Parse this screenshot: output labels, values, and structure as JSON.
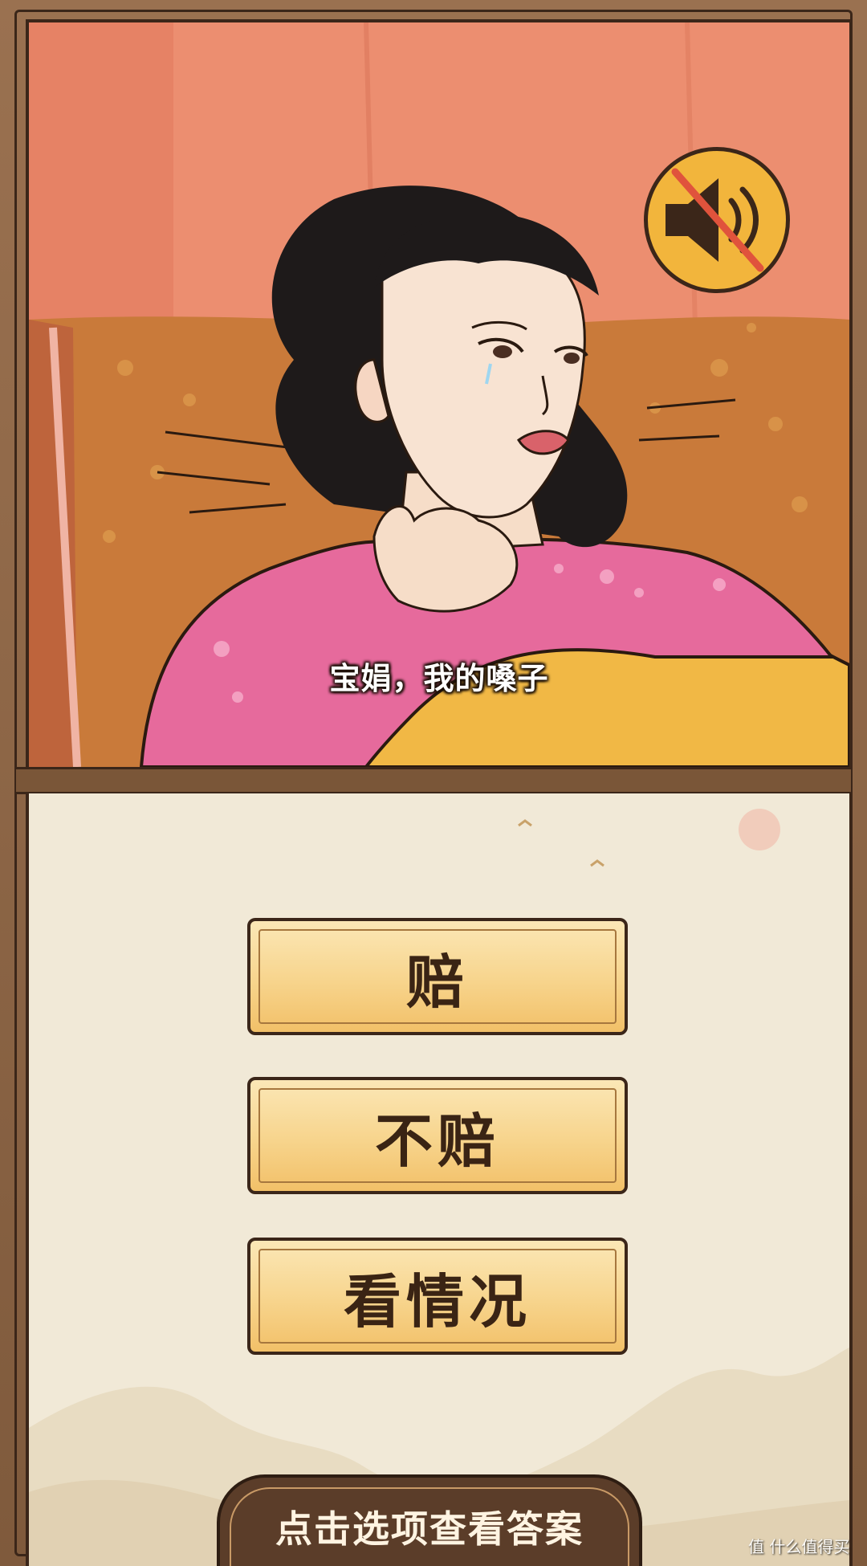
{
  "scene": {
    "subtitle": "宝娟，我的嗓子",
    "sound_button": {
      "icon": "speaker-muted-icon",
      "state": "muted"
    }
  },
  "options": [
    {
      "label": "赔"
    },
    {
      "label": "不赔"
    },
    {
      "label": "看情况"
    }
  ],
  "hint": {
    "label": "点击选项查看答案"
  },
  "watermark": "值 什么值得买",
  "colors": {
    "frame": "#8a6344",
    "outline": "#3b2619",
    "option_fill": "#f7d48c",
    "parchment": "#f1e9d7",
    "sound_button_fill": "#f2b53c",
    "mute_slash": "#e0533c"
  }
}
